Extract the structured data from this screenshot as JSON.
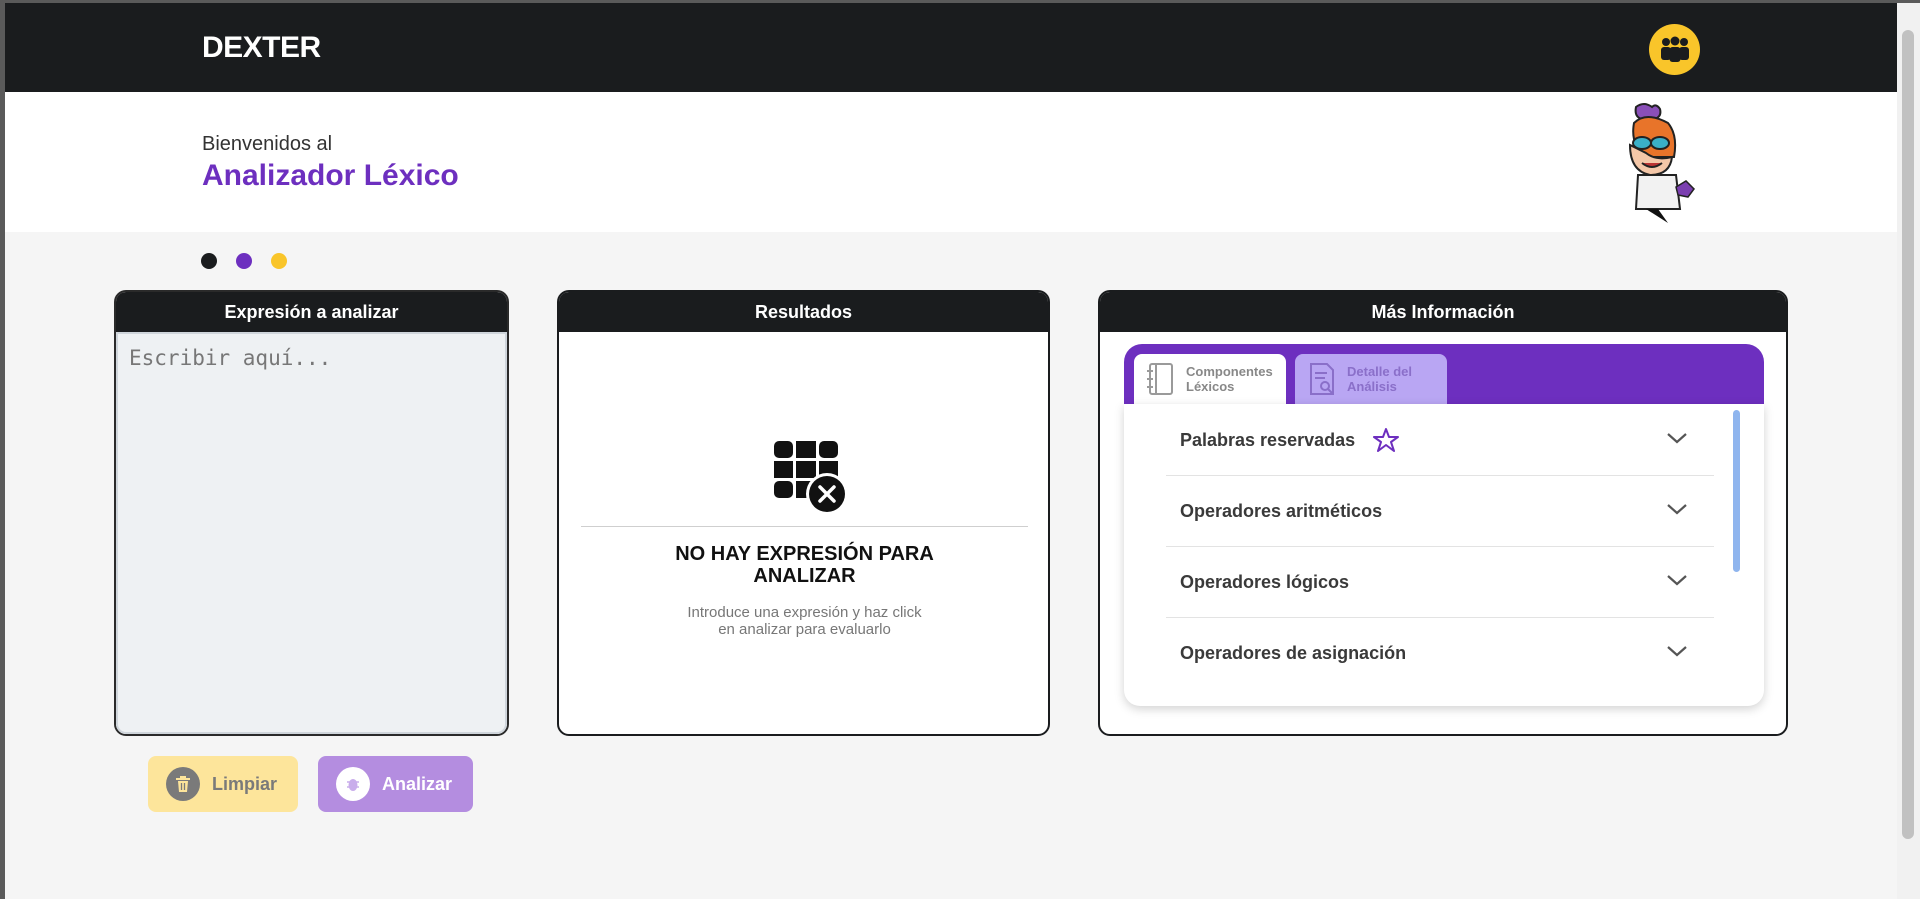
{
  "header": {
    "brand": "DEXTER",
    "team_icon": "team-icon"
  },
  "hero": {
    "welcome": "Bienvenidos al",
    "title": "Analizador Léxico"
  },
  "dots": {
    "colors": [
      "#1a1c1e",
      "#6d2fbf",
      "#f9c52a"
    ]
  },
  "expression_panel": {
    "title": "Expresión a analizar",
    "placeholder": "Escribir aquí..."
  },
  "results_panel": {
    "title": "Resultados",
    "empty_title": "NO HAY EXPRESIÓN PARA ANALIZAR",
    "empty_subtitle": "Introduce una expresión y haz click en analizar para evaluarlo"
  },
  "info_panel": {
    "title": "Más Información",
    "tabs": [
      {
        "label_line1": "Componentes",
        "label_line2": "Léxicos",
        "icon": "notebook-icon"
      },
      {
        "label_line1": "Detalle del",
        "label_line2": "Análisis",
        "icon": "document-search-icon"
      }
    ],
    "items": [
      {
        "label": "Palabras reservadas",
        "badge_icon": "pentagram-icon"
      },
      {
        "label": "Operadores aritméticos"
      },
      {
        "label": "Operadores lógicos"
      },
      {
        "label": "Operadores de asignación"
      }
    ]
  },
  "buttons": {
    "clear": "Limpiar",
    "analyze": "Analizar"
  },
  "colors": {
    "dark": "#1a1c1e",
    "purple": "#6d2fbf",
    "yellow": "#f9c52a"
  }
}
